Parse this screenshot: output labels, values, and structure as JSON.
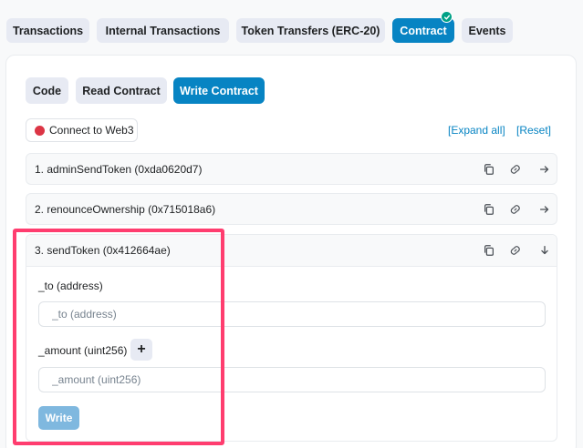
{
  "tabs": [
    "Transactions",
    "Internal Transactions",
    "Token Transfers (ERC-20)",
    "Contract",
    "Events"
  ],
  "subtabs": [
    "Code",
    "Read Contract",
    "Write Contract"
  ],
  "connect_label": "Connect to Web3",
  "expand_all": "[Expand all]",
  "reset": "[Reset]",
  "functions": [
    "1. adminSendToken (0xda0620d7)",
    "2. renounceOwnership (0x715018a6)",
    "3. sendToken (0x412664ae)"
  ],
  "form": {
    "to_label": "_to (address)",
    "to_placeholder": "_to (address)",
    "amount_label": "_amount (uint256)",
    "amount_placeholder": "_amount (uint256)",
    "plus": "+",
    "write": "Write"
  },
  "colors": {
    "accent": "#0784c3",
    "highlight": "#ff3d6f",
    "verified": "#00a186",
    "disconnected": "#dc3545"
  }
}
